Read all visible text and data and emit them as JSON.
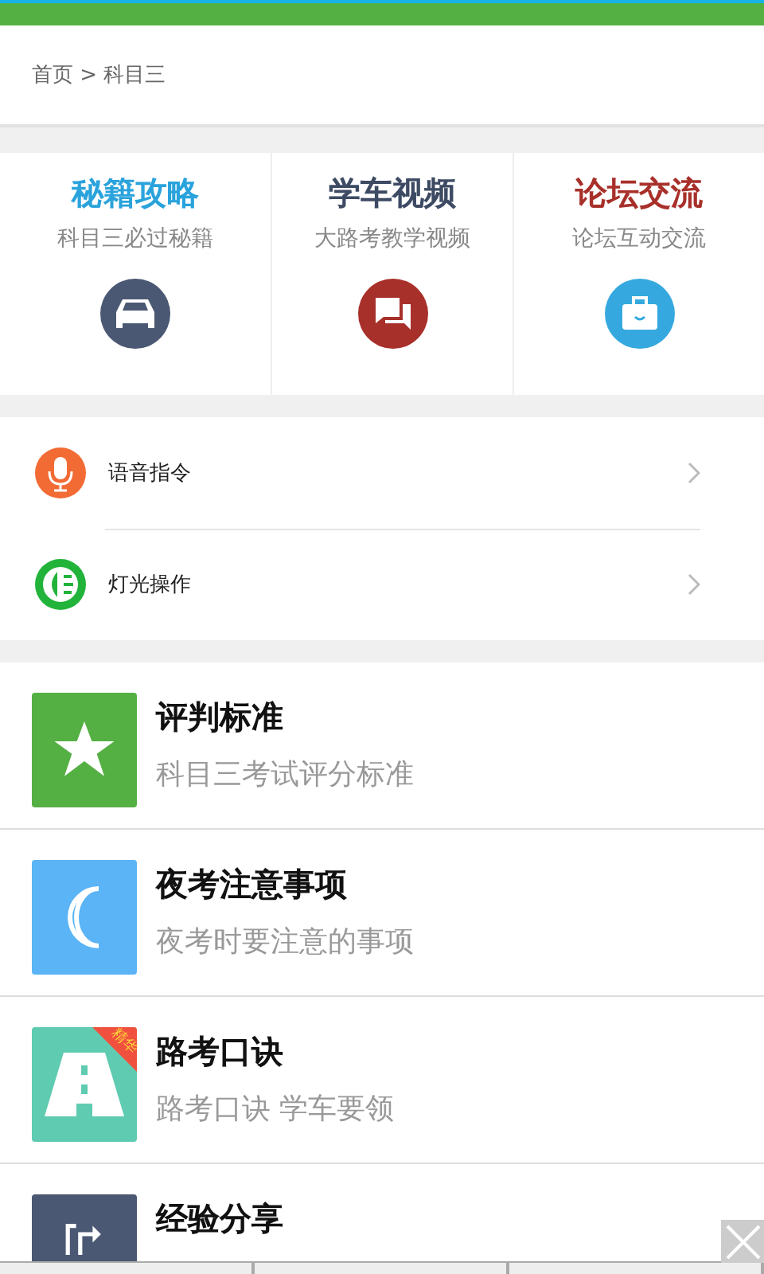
{
  "breadcrumb": "首页 > 科目三",
  "features": [
    {
      "title": "秘籍攻略",
      "subtitle": "科目三必过秘籍",
      "kind": "car",
      "color": "#2aa3dc"
    },
    {
      "title": "学车视频",
      "subtitle": "大路考教学视频",
      "kind": "chat",
      "color": "#3d4a63"
    },
    {
      "title": "论坛交流",
      "subtitle": "论坛互动交流",
      "kind": "bag",
      "color": "#a8302a"
    }
  ],
  "menu": [
    {
      "label": "语音指令",
      "kind": "mic",
      "color": "#f26b34"
    },
    {
      "label": "灯光操作",
      "kind": "light",
      "color": "#22b33a"
    }
  ],
  "articles": [
    {
      "title": "评判标准",
      "subtitle": "科目三考试评分标准",
      "kind": "star",
      "color": "#55b043"
    },
    {
      "title": "夜考注意事项",
      "subtitle": "夜考时要注意的事项",
      "kind": "moon",
      "color": "#5ab4f5"
    },
    {
      "title": "路考口诀",
      "subtitle": "路考口诀 学车要领",
      "kind": "road",
      "color": "#5fcbb0",
      "badge": "精华"
    },
    {
      "title": "经验分享",
      "kind": "route",
      "color": "#4a5873"
    }
  ]
}
